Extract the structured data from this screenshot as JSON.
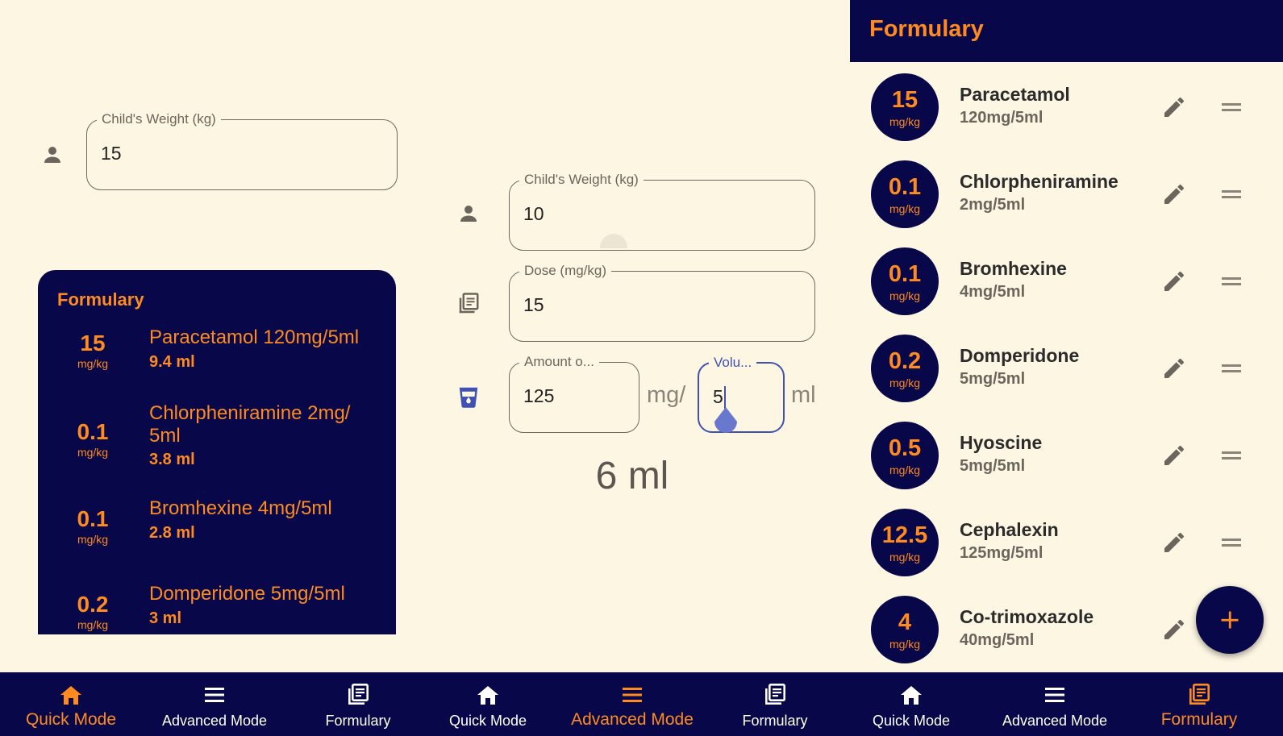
{
  "colors": {
    "background": "#fdf6e3",
    "navy": "#07074a",
    "accent": "#ff8a1f",
    "focus": "#3f51b5"
  },
  "quick_mode": {
    "weight_field": {
      "label": "Child's Weight (kg)",
      "value": "15"
    },
    "formulary_card": {
      "title": "Formulary",
      "items": [
        {
          "dose": "15",
          "unit": "mg/kg",
          "name": "Paracetamol 120mg/5ml",
          "volume": "9.4 ml"
        },
        {
          "dose": "0.1",
          "unit": "mg/kg",
          "name": "Chlorpheniramine 2mg/ 5ml",
          "volume": "3.8 ml"
        },
        {
          "dose": "0.1",
          "unit": "mg/kg",
          "name": "Bromhexine 4mg/5ml",
          "volume": "2.8 ml"
        },
        {
          "dose": "0.2",
          "unit": "mg/kg",
          "name": "Domperidone 5mg/5ml",
          "volume": "3 ml"
        }
      ]
    }
  },
  "advanced_mode": {
    "weight_field": {
      "label": "Child's Weight (kg)",
      "value": "10"
    },
    "dose_field": {
      "label": "Dose (mg/kg)",
      "value": "15"
    },
    "amount_field": {
      "label": "Amount o...",
      "value": "125"
    },
    "amount_unit": "mg/",
    "volume_field": {
      "label": "Volu...",
      "value": "5"
    },
    "volume_unit": "ml",
    "result": "6 ml"
  },
  "formulary": {
    "title": "Formulary",
    "items": [
      {
        "dose": "15",
        "unit": "mg/kg",
        "name": "Paracetamol",
        "concentration": "120mg/5ml"
      },
      {
        "dose": "0.1",
        "unit": "mg/kg",
        "name": "Chlorpheniramine",
        "concentration": "2mg/5ml"
      },
      {
        "dose": "0.1",
        "unit": "mg/kg",
        "name": "Bromhexine",
        "concentration": "4mg/5ml"
      },
      {
        "dose": "0.2",
        "unit": "mg/kg",
        "name": "Domperidone",
        "concentration": "5mg/5ml"
      },
      {
        "dose": "0.5",
        "unit": "mg/kg",
        "name": "Hyoscine",
        "concentration": "5mg/5ml"
      },
      {
        "dose": "12.5",
        "unit": "mg/kg",
        "name": "Cephalexin",
        "concentration": "125mg/5ml"
      },
      {
        "dose": "4",
        "unit": "mg/kg",
        "name": "Co-trimoxazole",
        "concentration": "40mg/5ml"
      }
    ]
  },
  "bottom_nav": {
    "screens": [
      {
        "quick": "Quick Mode",
        "advanced": "Advanced Mode",
        "formulary": "Formulary",
        "active": "quick"
      },
      {
        "quick": "Quick Mode",
        "advanced": "Advanced Mode",
        "formulary": "Formulary",
        "active": "advanced"
      },
      {
        "quick": "Quick Mode",
        "advanced": "Advanced Mode",
        "formulary": "Formulary",
        "active": "formulary"
      }
    ],
    "icons": {
      "quick": "home-icon",
      "advanced": "menu-icon",
      "formulary": "library-books-icon"
    }
  }
}
